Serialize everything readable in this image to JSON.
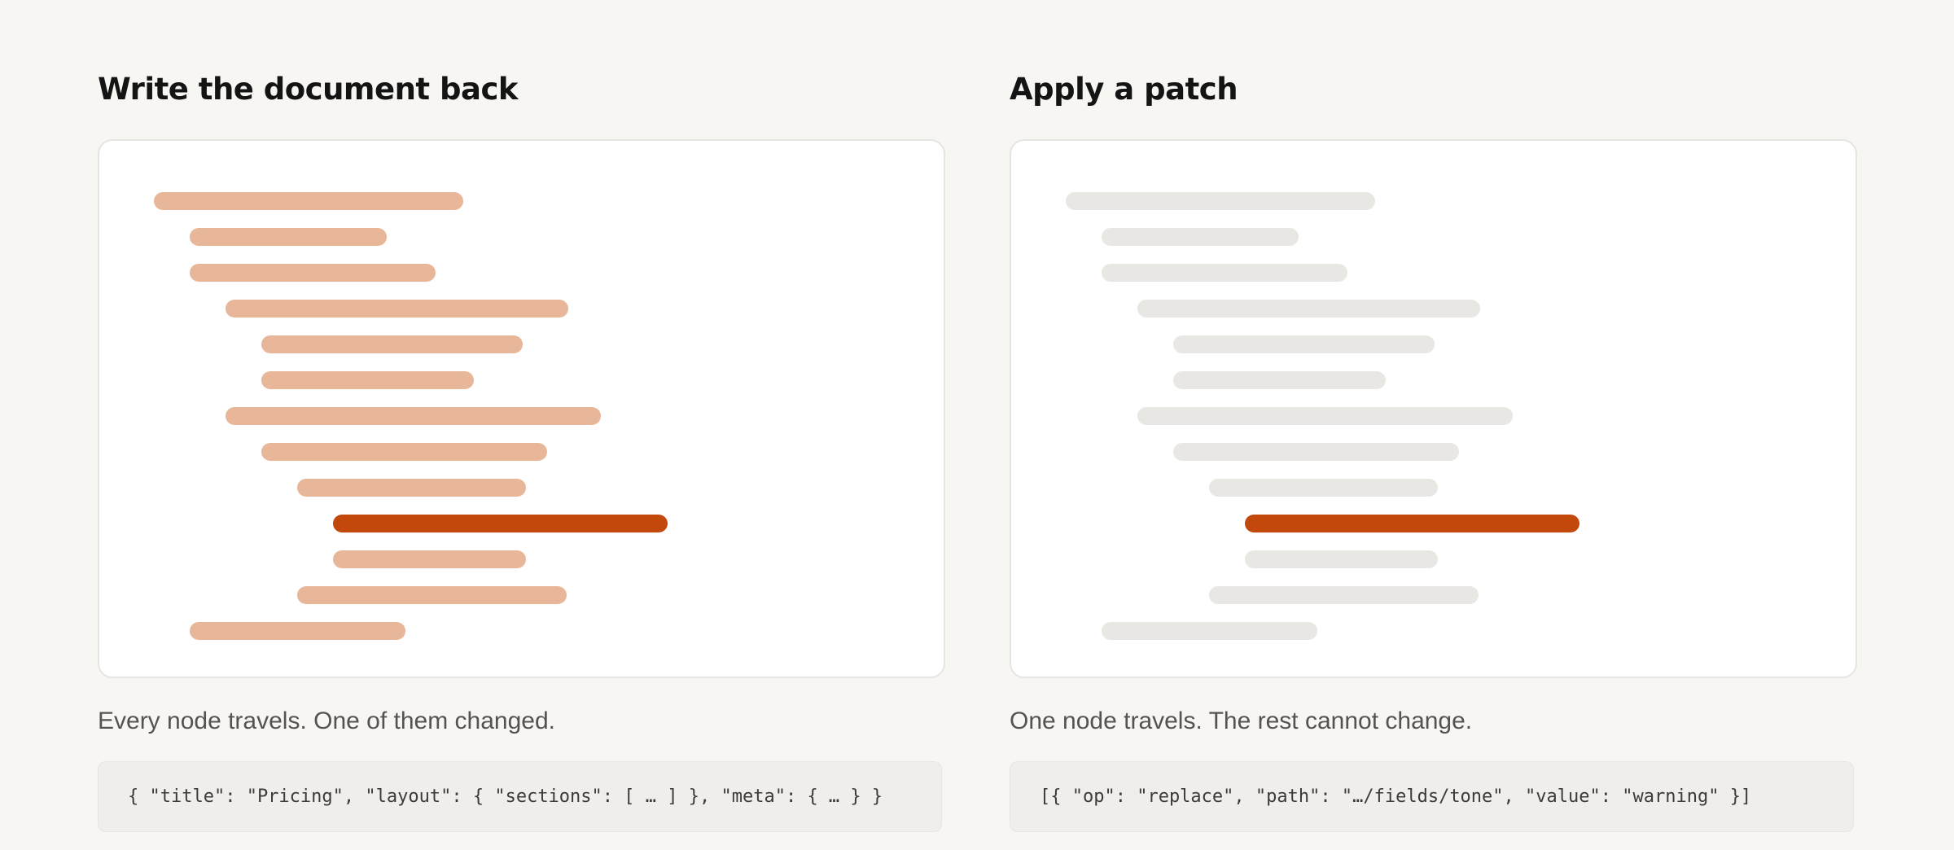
{
  "colors": {
    "bar_muted_warm": "#e8b699",
    "bar_muted_gray": "#e8e7e3",
    "bar_highlight": "#c2490b"
  },
  "panels": [
    {
      "title": "Write the document back",
      "caption": "Every node travels. One of them changed.",
      "code": "{ \"title\": \"Pricing\", \"layout\": { \"sections\": [ … ] }, \"meta\": { … } }",
      "bar_style": "all-traveling",
      "highlighted_node_index": 9
    },
    {
      "title": "Apply a patch",
      "caption": "One node travels. The rest cannot change.",
      "code": "[{ \"op\": \"replace\", \"path\": \"…/fields/tone\", \"value\": \"warning\" }]",
      "bar_style": "single-traveling",
      "highlighted_node_index": 9
    }
  ]
}
